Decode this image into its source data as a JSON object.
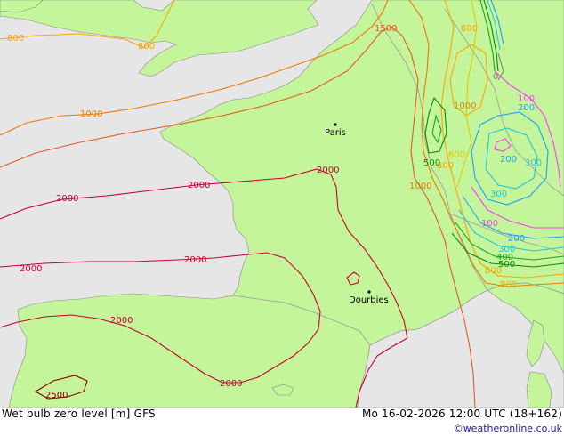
{
  "colors": {
    "sea": "#e6e6e6",
    "land": "#c4f59a",
    "land_outside": "#ebebeb",
    "border": "#9c9c9c",
    "coast": "#8a8a8a",
    "c100": "#ff38ff",
    "c200": "#1ea0ff",
    "c300": "#1ec8e6",
    "c400": "#16a916",
    "c500": "#0a8c0a",
    "c600": "#e6c800",
    "c800": "#ffa500",
    "c1000": "#f07800",
    "c1500": "#e65a1e",
    "c2000": "#c80032",
    "c2500": "#800000"
  },
  "cities": [
    {
      "name": "Paris"
    },
    {
      "name": "Dourbies"
    }
  ],
  "contour_labels": {
    "l800_a": "800",
    "l800_b": "800",
    "l1000_a": "1000",
    "l1500_a": "1500",
    "l2000_a": "2000",
    "l2000_b": "2000",
    "l2000_c": "2000",
    "l2000_d": "2000",
    "l2000_e": "2000",
    "l2000_f": "2000",
    "l2000_g": "2000",
    "l2500_a": "2500",
    "l800_alps1": "800",
    "l1000_alps1": "1000",
    "l1000_alps2": "1000",
    "l600_a": "600",
    "l800_alps2": "800",
    "l500_a": "500",
    "l100_a": "100",
    "l200_a": "200",
    "l200_b": "200",
    "l300_a": "300",
    "l300_b": "300",
    "l100_b": "100",
    "l200_c": "200",
    "l300_c": "300",
    "l400_a": "400",
    "l500_b": "500",
    "l800_alps3": "800",
    "l800_alps4": "800",
    "l0_a": "0"
  },
  "footer": {
    "title": "Wet bulb zero level [m] GFS",
    "time": "Mo 16-02-2026 12:00 UTC (18+162)",
    "credit": "©weatheronline.co.uk"
  }
}
